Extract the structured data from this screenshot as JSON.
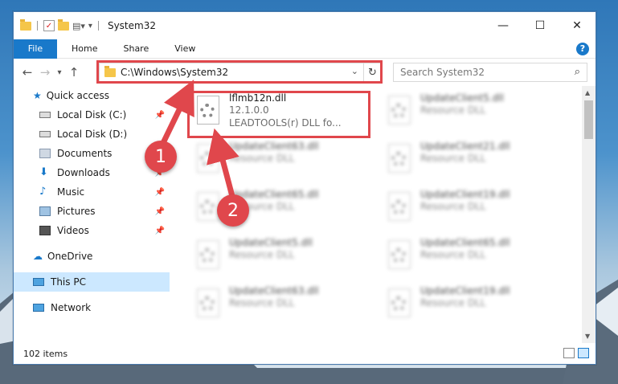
{
  "window": {
    "title": "System32"
  },
  "ribbon": {
    "tabs": [
      "File",
      "Home",
      "Share",
      "View"
    ]
  },
  "address": {
    "path": "C:\\Windows\\System32",
    "search_placeholder": "Search System32"
  },
  "nav": {
    "items": [
      {
        "label": "Quick access",
        "icon": "star-icon",
        "level": 0
      },
      {
        "label": "Local Disk (C:)",
        "icon": "drive-icon",
        "level": 1,
        "pinned": true
      },
      {
        "label": "Local Disk (D:)",
        "icon": "drive-icon",
        "level": 1
      },
      {
        "label": "Documents",
        "icon": "documents-icon",
        "level": 1,
        "pinned": true
      },
      {
        "label": "Downloads",
        "icon": "download-icon",
        "level": 1,
        "pinned": true
      },
      {
        "label": "Music",
        "icon": "music-icon",
        "level": 1,
        "pinned": true
      },
      {
        "label": "Pictures",
        "icon": "pictures-icon",
        "level": 1,
        "pinned": true
      },
      {
        "label": "Videos",
        "icon": "videos-icon",
        "level": 1,
        "pinned": true
      },
      {
        "label": "OneDrive",
        "icon": "cloud-icon",
        "level": 0
      },
      {
        "label": "This PC",
        "icon": "pc-icon",
        "level": 0,
        "selected": true
      },
      {
        "label": "Network",
        "icon": "network-icon",
        "level": 0
      }
    ]
  },
  "files": [
    {
      "name": "lflmb12n.dll",
      "line2": "12.1.0.0",
      "line3": "LEADTOOLS(r) DLL fo...",
      "highlighted": true
    },
    {
      "name": "UpdateClient5.dll",
      "line2": "Resource DLL"
    },
    {
      "name": "UpdateClient63.dll",
      "line2": "Resource DLL"
    },
    {
      "name": "UpdateClient21.dll",
      "line2": "Resource DLL"
    },
    {
      "name": "UpdateClient65.dll",
      "line2": "Resource DLL"
    },
    {
      "name": "UpdateClient19.dll",
      "line2": "Resource DLL"
    },
    {
      "name": "UpdateClient5.dll",
      "line2": "Resource DLL"
    },
    {
      "name": "UpdateClient65.dll",
      "line2": "Resource DLL"
    },
    {
      "name": "UpdateClient63.dll",
      "line2": "Resource DLL"
    },
    {
      "name": "UpdateClient19.dll",
      "line2": "Resource DLL"
    }
  ],
  "status": {
    "items": "102 items"
  },
  "annotations": {
    "badge1": "1",
    "badge2": "2",
    "color": "#e0474c"
  }
}
